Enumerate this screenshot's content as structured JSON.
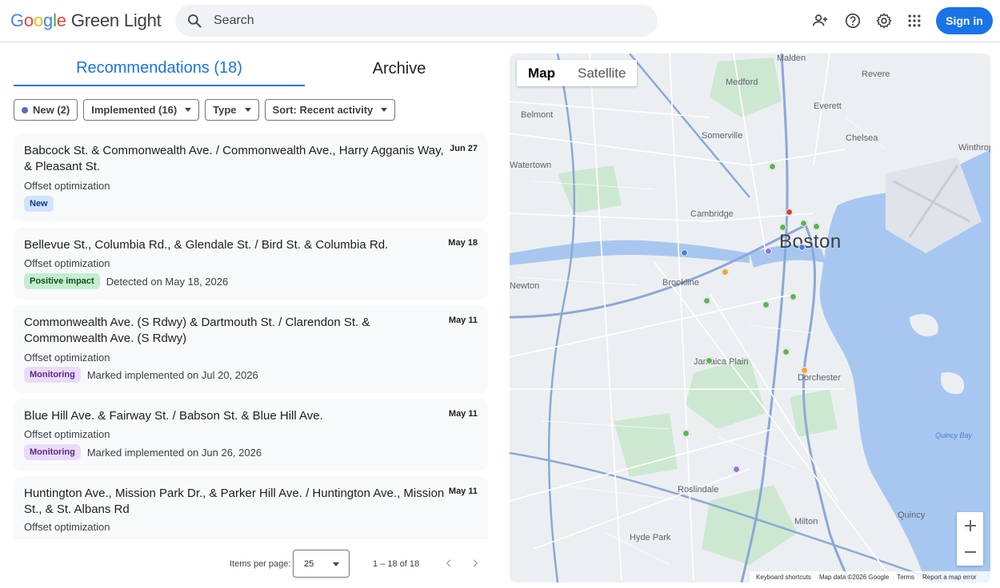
{
  "header": {
    "logo_word": [
      "G",
      "o",
      "o",
      "g",
      "l",
      "e"
    ],
    "logo_colors": [
      "#4285F4",
      "#EA4335",
      "#FBBC05",
      "#4285F4",
      "#34A853",
      "#EA4335"
    ],
    "product_name": "Green Light",
    "search_placeholder": "Search",
    "icons": [
      "add-person-icon",
      "help-icon",
      "settings-icon",
      "apps-icon"
    ],
    "sign_in_label": "Sign in"
  },
  "tabs": [
    {
      "label": "Recommendations (18)",
      "active": true
    },
    {
      "label": "Archive",
      "active": false
    }
  ],
  "filters": {
    "new": "New (2)",
    "implemented": "Implemented (16)",
    "type": "Type",
    "sort": "Sort: Recent activity"
  },
  "recommendations": [
    {
      "title": "Babcock St. & Commonwealth Ave.  /  Commonwealth Ave., Harry Agganis Way, & Pleasant St.",
      "date": "Jun 27",
      "type": "Offset optimization",
      "badge": "New",
      "badge_kind": "new",
      "note": ""
    },
    {
      "title": "Bellevue St., Columbia Rd., & Glendale St.  /  Bird St. & Columbia Rd.",
      "date": "May 18",
      "type": "Offset optimization",
      "badge": "Positive impact",
      "badge_kind": "positive",
      "note": "Detected on May 18, 2026"
    },
    {
      "title": "Commonwealth Ave. (S Rdwy) & Dartmouth St.  /  Clarendon St. & Commonwealth Ave. (S Rdwy)",
      "date": "May 11",
      "type": "Offset optimization",
      "badge": "Monitoring",
      "badge_kind": "monitoring",
      "note": "Marked implemented on Jul 20, 2026"
    },
    {
      "title": "Blue Hill Ave. & Fairway St.  /  Babson St. & Blue Hill Ave.",
      "date": "May 11",
      "type": "Offset optimization",
      "badge": "Monitoring",
      "badge_kind": "monitoring",
      "note": "Marked implemented on Jun 26, 2026"
    },
    {
      "title": "Huntington Ave., Mission Park Dr., & Parker Hill Ave.  /  Huntington Ave., Mission St., & St. Albans Rd",
      "date": "May 11",
      "type": "Offset optimization",
      "badge": "",
      "badge_kind": "",
      "note": ""
    }
  ],
  "pagination": {
    "items_per_page_label": "Items per page:",
    "items_per_page_value": "25",
    "range_text": "1 – 18 of 18"
  },
  "map": {
    "toggle": {
      "map": "Map",
      "satellite": "Satellite",
      "selected": "Map"
    },
    "labels": [
      "Malden",
      "Revere",
      "Medford",
      "Everett",
      "Chelsea",
      "Belmont",
      "Somerville",
      "Watertown",
      "Cambridge",
      "Winthrop",
      "Boston",
      "Brookline",
      "Newton",
      "Jamaica Plain",
      "Dorchester",
      "Roslindale",
      "Quincy Bay",
      "Milton",
      "Quincy",
      "Hyde Park"
    ],
    "marker_colors": {
      "green": "#5bb554",
      "blue": "#4a7fe0",
      "purple": "#9b6fe0",
      "orange": "#f0a531",
      "red": "#d44535"
    },
    "footer": {
      "shortcuts": "Keyboard shortcuts",
      "attribution": "Map data ©2026 Google",
      "terms": "Terms",
      "report": "Report a map error"
    }
  }
}
